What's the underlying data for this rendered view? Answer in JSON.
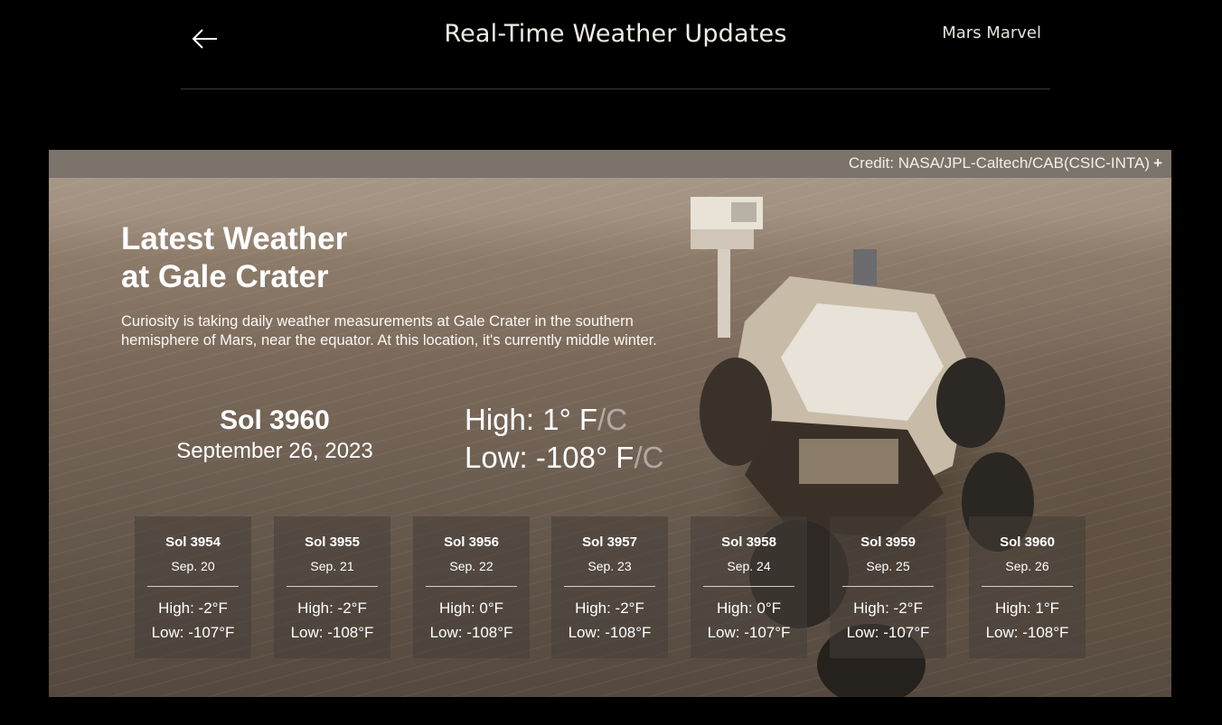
{
  "header": {
    "title": "Real-Time Weather Updates",
    "brand": "Mars Marvel",
    "back_icon": "arrow-left-icon"
  },
  "hero": {
    "credit": "Credit: NASA/JPL-Caltech/CAB(CSIC-INTA)",
    "credit_toggle": "+",
    "heading_line1": "Latest Weather",
    "heading_line2": "at Gale Crater",
    "description": "Curiosity is taking daily weather measurements at Gale Crater in the southern hemisphere of Mars, near the equator. At this location, it's currently middle winter.",
    "current": {
      "sol": "Sol 3960",
      "date": "September 26, 2023",
      "high_label": "High:",
      "high_value": "1° F",
      "low_label": "Low:",
      "low_value": "-108° F",
      "unit_separator": "/",
      "alt_unit": "C"
    }
  },
  "days": [
    {
      "sol": "Sol 3954",
      "date": "Sep. 20",
      "high": "High: -2°F",
      "low": "Low: -107°F"
    },
    {
      "sol": "Sol 3955",
      "date": "Sep. 21",
      "high": "High: -2°F",
      "low": "Low: -108°F"
    },
    {
      "sol": "Sol 3956",
      "date": "Sep. 22",
      "high": "High: 0°F",
      "low": "Low: -108°F"
    },
    {
      "sol": "Sol 3957",
      "date": "Sep. 23",
      "high": "High: -2°F",
      "low": "Low: -108°F"
    },
    {
      "sol": "Sol 3958",
      "date": "Sep. 24",
      "high": "High: 0°F",
      "low": "Low: -107°F"
    },
    {
      "sol": "Sol 3959",
      "date": "Sep. 25",
      "high": "High: -2°F",
      "low": "Low: -107°F"
    },
    {
      "sol": "Sol 3960",
      "date": "Sep. 26",
      "high": "High: 1°F",
      "low": "Low: -108°F"
    }
  ]
}
